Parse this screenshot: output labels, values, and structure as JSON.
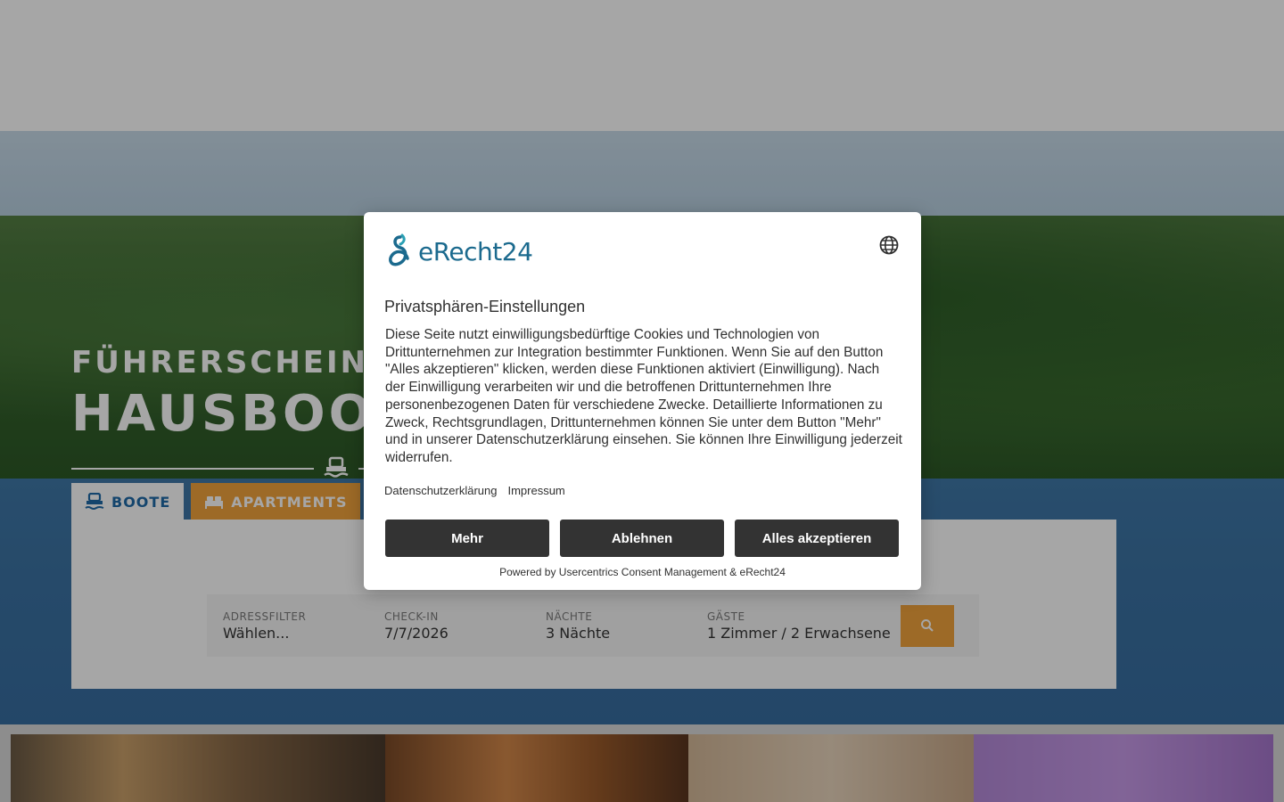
{
  "hero": {
    "tagline": "FÜHRERSCHEINF",
    "title": "HAUSBOOT",
    "tabs": [
      {
        "label": "BOOTE",
        "icon": "ship-icon"
      },
      {
        "label": "APARTMENTS",
        "icon": "bed-icon"
      }
    ]
  },
  "search": {
    "address_label": "ADRESSFILTER",
    "address_value": "Wählen...",
    "checkin_label": "CHECK-IN",
    "checkin_value": "7/7/2026",
    "nights_label": "NÄCHTE",
    "nights_value": "3 Nächte",
    "guests_label": "GÄSTE",
    "guests_value": "1 Zimmer / 2 Erwachsene",
    "button_icon": "search-icon"
  },
  "consent": {
    "logo_text": "eRecht24",
    "title": "Privatsphären-Einstellungen",
    "description": "Diese Seite nutzt einwilligungsbedürftige Cookies und Technologien von Drittunternehmen zur Integration bestimmter Funktionen. Wenn Sie auf den Button \"Alles akzeptieren\" klicken, werden diese Funktionen aktiviert (Einwilligung). Nach der Einwilligung verarbeiten wir und die betroffenen Drittunternehmen Ihre personenbezogenen Daten für verschiedene Zwecke. Detaillierte Informationen zu Zweck, Rechtsgrundlagen, Drittunternehmen können Sie unter dem Button \"Mehr\" und in unserer Datenschutzerklärung einsehen. Sie können Ihre Einwilligung jederzeit widerrufen.",
    "link_privacy": "Datenschutzerklärung",
    "link_imprint": "Impressum",
    "btn_more": "Mehr",
    "btn_decline": "Ablehnen",
    "btn_accept": "Alles akzeptieren",
    "powered_by": "Powered by Usercentrics Consent Management & eRecht24",
    "globe_icon": "globe-icon"
  },
  "colors": {
    "accent_orange": "#f1a33c",
    "brand_blue": "#1f6aa8",
    "button_dark": "#333333",
    "logo_teal": "#1b6a8e"
  }
}
